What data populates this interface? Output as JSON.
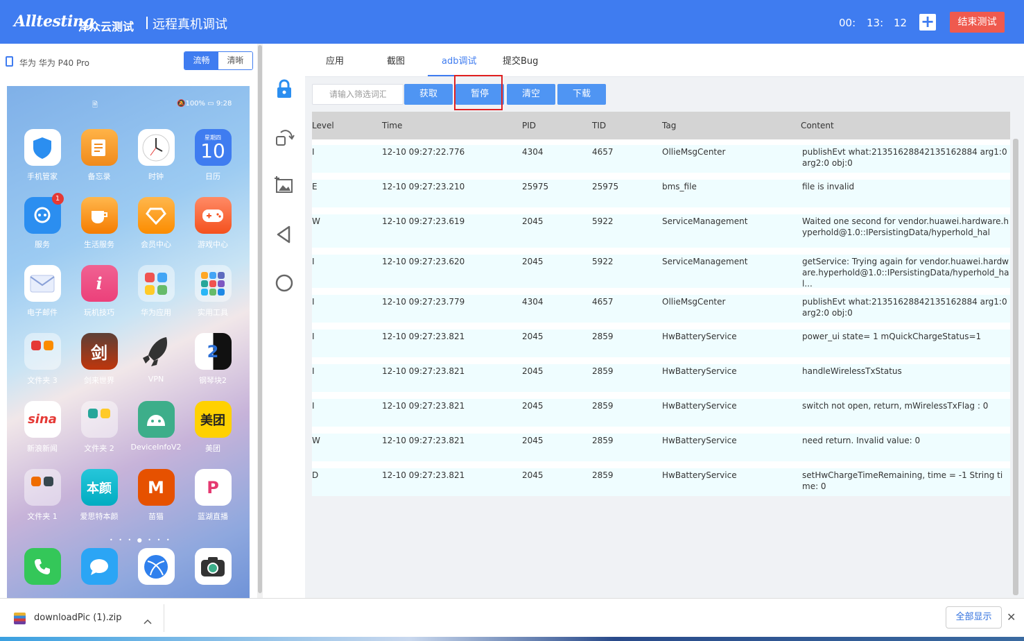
{
  "header": {
    "brand": "Alltesting",
    "brand_cn": "泽众云测试",
    "title": "远程真机调试",
    "timer": {
      "h": "00:",
      "m": "13:",
      "s": "12"
    },
    "plus_label": "+",
    "end_button": "结束测试",
    "colors": {
      "bar": "#3f7cf0",
      "end": "#ef5a4e"
    }
  },
  "device": {
    "name": "华为 华为 P40 Pro",
    "quality_options": [
      "流畅",
      "清晰"
    ],
    "selected_quality": "流畅"
  },
  "phone": {
    "status_left": "🗎",
    "status_right": "🔕100% ▭ 9:28",
    "apps": [
      {
        "label": "手机管家",
        "icon": "shield-icon"
      },
      {
        "label": "备忘录",
        "icon": "notes-icon"
      },
      {
        "label": "时钟",
        "icon": "clock-icon"
      },
      {
        "label": "日历",
        "icon": "calendar-icon",
        "text": "10",
        "sub": "星期四"
      },
      {
        "label": "服务",
        "icon": "service-icon",
        "badge": "1"
      },
      {
        "label": "生活服务",
        "icon": "cup-icon"
      },
      {
        "label": "会员中心",
        "icon": "diamond-icon"
      },
      {
        "label": "游戏中心",
        "icon": "gamepad-icon"
      },
      {
        "label": "电子邮件",
        "icon": "mail-icon"
      },
      {
        "label": "玩机技巧",
        "icon": "tips-icon",
        "text": "i"
      },
      {
        "label": "华为应用",
        "icon": "folder-icon"
      },
      {
        "label": "实用工具",
        "icon": "folder-icon"
      },
      {
        "label": "文件夹 3",
        "icon": "folder-icon"
      },
      {
        "label": "剑来世界",
        "icon": "game-icon",
        "text": "剑"
      },
      {
        "label": "VPN",
        "icon": "rocket-icon"
      },
      {
        "label": "钢琴块2",
        "icon": "piano-icon",
        "text": "2"
      },
      {
        "label": "新浪新闻",
        "icon": "sina-icon",
        "text": "sina"
      },
      {
        "label": "文件夹 2",
        "icon": "folder-icon"
      },
      {
        "label": "DeviceInfoV2",
        "icon": "android-icon"
      },
      {
        "label": "美团",
        "icon": "meituan-icon",
        "text": "美团"
      },
      {
        "label": "文件夹 1",
        "icon": "folder-icon"
      },
      {
        "label": "爱思特本颜",
        "icon": "benyan-icon",
        "text": "本颜"
      },
      {
        "label": "苗猫",
        "icon": "maomao-icon",
        "text": "M"
      },
      {
        "label": "蓝湖直播",
        "icon": "live-icon",
        "text": "P"
      }
    ],
    "page_dots": "• • • ● • • •",
    "dock": [
      "phone-icon",
      "message-icon",
      "browser-icon",
      "camera-icon"
    ]
  },
  "tabs": [
    "应用",
    "截图",
    "adb调试",
    "提交Bug"
  ],
  "active_tab": "adb调试",
  "toolbar": {
    "filter_placeholder": "请输入筛选词汇",
    "buttons": [
      "获取",
      "暂停",
      "清空",
      "下载"
    ]
  },
  "table": {
    "headers": [
      "Level",
      "Time",
      "PID",
      "TID",
      "Tag",
      "Content"
    ],
    "rows": [
      {
        "level": "I",
        "time": "12-10 09:27:22.776",
        "pid": "4304",
        "tid": "4657",
        "tag": "OllieMsgCenter",
        "content": "publishEvt what:21351628842135162884 arg1:0 arg2:0 obj:0"
      },
      {
        "level": "E",
        "time": "12-10 09:27:23.210",
        "pid": "25975",
        "tid": "25975",
        "tag": "bms_file",
        "content": "file is invalid"
      },
      {
        "level": "W",
        "time": "12-10 09:27:23.619",
        "pid": "2045",
        "tid": "5922",
        "tag": "ServiceManagement",
        "content": "Waited one second for vendor.huawei.hardware.hyperhold@1.0::IPersistingData/hyperhold_hal"
      },
      {
        "level": "I",
        "time": "12-10 09:27:23.620",
        "pid": "2045",
        "tid": "5922",
        "tag": "ServiceManagement",
        "content": "getService: Trying again for vendor.huawei.hardware.hyperhold@1.0::IPersistingData/hyperhold_hal..."
      },
      {
        "level": "I",
        "time": "12-10 09:27:23.779",
        "pid": "4304",
        "tid": "4657",
        "tag": "OllieMsgCenter",
        "content": "publishEvt what:21351628842135162884 arg1:0 arg2:0 obj:0"
      },
      {
        "level": "I",
        "time": "12-10 09:27:23.821",
        "pid": "2045",
        "tid": "2859",
        "tag": "HwBatteryService",
        "content": "power_ui state= 1 mQuickChargeStatus=1"
      },
      {
        "level": "I",
        "time": "12-10 09:27:23.821",
        "pid": "2045",
        "tid": "2859",
        "tag": "HwBatteryService",
        "content": "handleWirelessTxStatus"
      },
      {
        "level": "I",
        "time": "12-10 09:27:23.821",
        "pid": "2045",
        "tid": "2859",
        "tag": "HwBatteryService",
        "content": "switch not open, return, mWirelessTxFlag : 0"
      },
      {
        "level": "W",
        "time": "12-10 09:27:23.821",
        "pid": "2045",
        "tid": "2859",
        "tag": "HwBatteryService",
        "content": "need return. Invalid value: 0"
      },
      {
        "level": "D",
        "time": "12-10 09:27:23.821",
        "pid": "2045",
        "tid": "2859",
        "tag": "HwBatteryService",
        "content": "setHwChargeTimeRemaining, time = -1 String time: 0"
      }
    ]
  },
  "downloads": {
    "file": "downloadPic (1).zip",
    "show_all": "全部显示",
    "close": "✕"
  }
}
